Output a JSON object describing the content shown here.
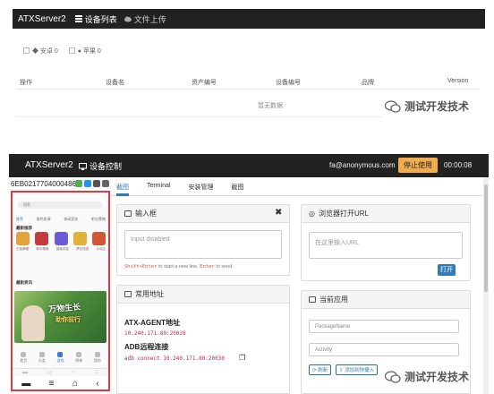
{
  "device_list": {
    "navbar": {
      "brand": "ATXServer2",
      "nav_items": [
        {
          "label": "设备列表",
          "icon": "list-icon"
        },
        {
          "label": "文件上传",
          "icon": "cloud-upload-icon"
        }
      ]
    },
    "filters": [
      {
        "label": "安卓 0",
        "icon": "android-icon"
      },
      {
        "label": "苹果 0",
        "icon": "apple-icon"
      }
    ],
    "table": {
      "columns": [
        "操作",
        "设备名",
        "资产编号",
        "设备编号",
        "品牌",
        "Version"
      ],
      "empty_text": "暂无数据"
    }
  },
  "watermark": "测试开发技术",
  "device_control": {
    "navbar": {
      "brand": "ATXServer2",
      "page_title": "设备控制",
      "user": "fa@anonymous.com",
      "stop_button": "停止使用",
      "timer": "00:00:08"
    },
    "phone": {
      "serial": "6EB0217704000486",
      "keys": [
        "▬",
        "≡",
        "⌂",
        "‹"
      ],
      "screen": {
        "search_hint": "搜索",
        "tabs": [
          "推荐",
          "角色扮演",
          "休闲竞技",
          "射击策略"
        ],
        "section1": "最新推荐",
        "section2": "最新资讯",
        "banner_title": "万物生长",
        "banner_sub": "助你前行",
        "apps": [
          "王者荣耀",
          "和平精英",
          "部落冲突",
          "梦幻西游",
          "斗地主"
        ],
        "bottom_nav": [
          "首页",
          "分类",
          "游戏",
          "榜单",
          "我的"
        ]
      }
    },
    "tabs": [
      "截图",
      "Terminal",
      "安装管理",
      "截图"
    ],
    "active_tab": 0,
    "input_panel": {
      "title": "输入框",
      "placeholder": "Input disabled",
      "hint_prefix": "Shift+Enter",
      "hint_mid": "to start a new line,",
      "hint_key": "Enter",
      "hint_suffix": "to send"
    },
    "browser_panel": {
      "title": "浏览器打开URL",
      "placeholder": "在这里输入URL",
      "open_button": "打开"
    },
    "address_panel": {
      "title": "常用地址",
      "atx_label": "ATX-AGENT地址",
      "atx_address": "10.240.171.80:20028",
      "adb_label": "ADB远程连接",
      "adb_command": "adb connect 10.240.171.80:20030"
    },
    "app_panel": {
      "title": "当前应用",
      "package_placeholder": "PackageName",
      "activity_placeholder": "Activity",
      "refresh_button": "刷新",
      "add_shortcut_button": "添加到快捷入"
    },
    "colors": {
      "navbar": "#222222",
      "stop_button": "#f0ad4e",
      "primary": "#337ab7",
      "highlight_box": "#e0393e"
    }
  }
}
